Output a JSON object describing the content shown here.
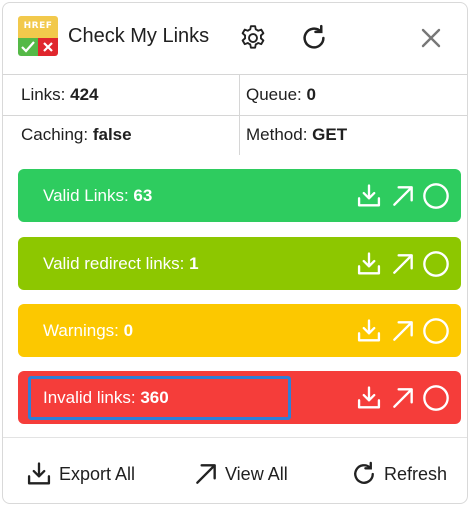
{
  "header": {
    "logo_text": "HREF",
    "title": "Check My Links"
  },
  "stats": {
    "links_label": "Links:",
    "links_value": "424",
    "queue_label": "Queue:",
    "queue_value": "0",
    "caching_label": "Caching:",
    "caching_value": "false",
    "method_label": "Method:",
    "method_value": "GET"
  },
  "rows": [
    {
      "label": "Valid Links:",
      "count": "63",
      "color": "#2ecc5f"
    },
    {
      "label": "Valid redirect links:",
      "count": "1",
      "color": "#8dc700"
    },
    {
      "label": "Warnings:",
      "count": "0",
      "color": "#fcc800"
    },
    {
      "label": "Invalid links:",
      "count": "360",
      "color": "#f53d3a"
    }
  ],
  "footer": {
    "export_label": "Export All",
    "view_label": "View All",
    "refresh_label": "Refresh"
  },
  "icons": {
    "row_actions": [
      "download-icon",
      "open-external-icon",
      "circle-toggle-icon"
    ],
    "header": [
      "settings-gear-icon",
      "reload-icon",
      "close-icon"
    ]
  },
  "accent_focus": "#2f7fd6"
}
